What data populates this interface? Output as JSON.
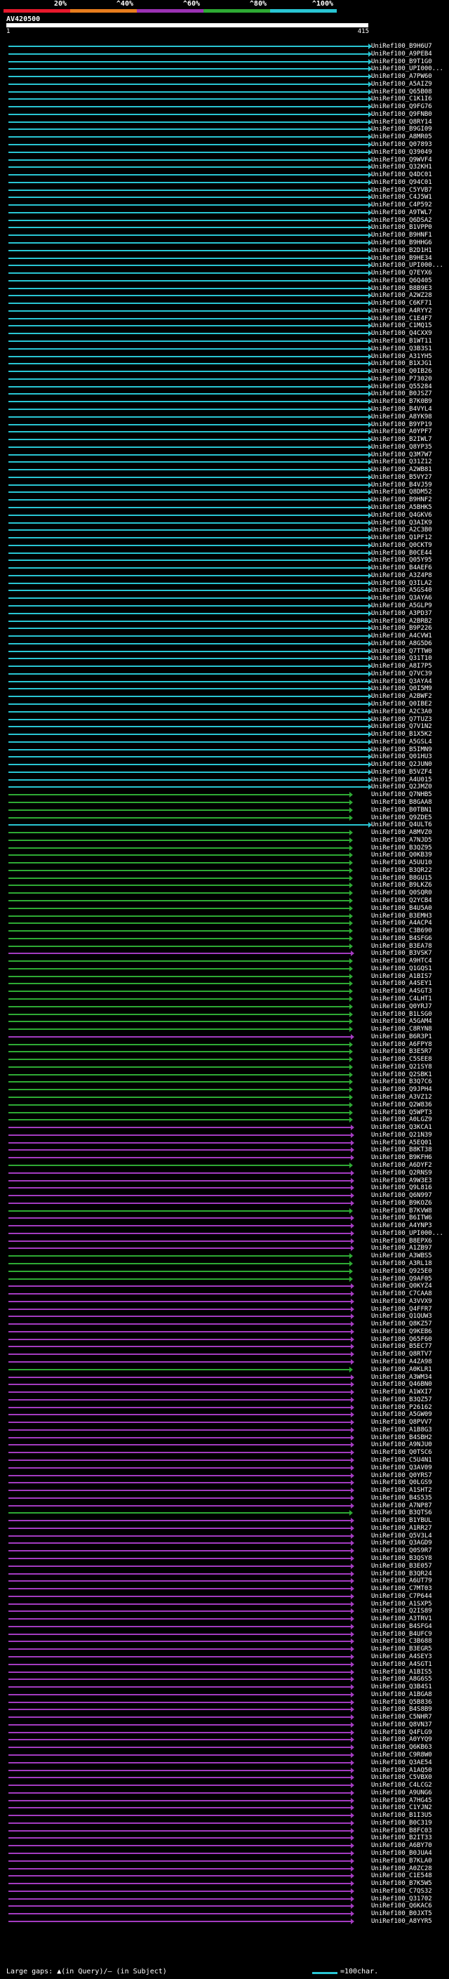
{
  "legend": {
    "labels": [
      "20%",
      "^40%",
      "^60%",
      "^80%",
      "^100%"
    ],
    "colors": [
      "#e8192c",
      "#e87d1e",
      "#9b32b4",
      "#2eaa34",
      "#29c5d3"
    ]
  },
  "query": {
    "name": "AV420500",
    "start": "1",
    "end": "415"
  },
  "hits": [
    {
      "label": "UniRef100_B9H6U7",
      "color": "cyan"
    },
    {
      "label": "UniRef100_A9PEB4",
      "color": "cyan"
    },
    {
      "label": "UniRef100_B9T1G0",
      "color": "cyan"
    },
    {
      "label": "UniRef100_UPI000...",
      "color": "cyan"
    },
    {
      "label": "UniRef100_A7PW60",
      "color": "cyan"
    },
    {
      "label": "UniRef100_A5AIZ9",
      "color": "cyan"
    },
    {
      "label": "UniRef100_Q65B08",
      "color": "cyan"
    },
    {
      "label": "UniRef100_C1K1I6",
      "color": "cyan"
    },
    {
      "label": "UniRef100_Q9FG76",
      "color": "cyan"
    },
    {
      "label": "UniRef100_Q9FNB0",
      "color": "cyan"
    },
    {
      "label": "UniRef100_Q8RY14",
      "color": "cyan"
    },
    {
      "label": "UniRef100_B9GI09",
      "color": "cyan"
    },
    {
      "label": "UniRef100_A8MR05",
      "color": "cyan"
    },
    {
      "label": "UniRef100_Q07893",
      "color": "cyan"
    },
    {
      "label": "UniRef100_Q39049",
      "color": "cyan"
    },
    {
      "label": "UniRef100_Q9WVF4",
      "color": "cyan"
    },
    {
      "label": "UniRef100_Q32KH1",
      "color": "cyan"
    },
    {
      "label": "UniRef100_Q4DC01",
      "color": "cyan"
    },
    {
      "label": "UniRef100_Q94C01",
      "color": "cyan"
    },
    {
      "label": "UniRef100_C5YVB7",
      "color": "cyan"
    },
    {
      "label": "UniRef100_C4J5W1",
      "color": "cyan"
    },
    {
      "label": "UniRef100_C4P592",
      "color": "cyan"
    },
    {
      "label": "UniRef100_A9TWL7",
      "color": "cyan"
    },
    {
      "label": "UniRef100_Q6DSA2",
      "color": "cyan"
    },
    {
      "label": "UniRef100_B1VPP0",
      "color": "cyan"
    },
    {
      "label": "UniRef100_B9HNF1",
      "color": "cyan"
    },
    {
      "label": "UniRef100_B9HHG6",
      "color": "cyan"
    },
    {
      "label": "UniRef100_B2D1H1",
      "color": "cyan"
    },
    {
      "label": "UniRef100_B9HE34",
      "color": "cyan"
    },
    {
      "label": "UniRef100_UPI000...",
      "color": "cyan"
    },
    {
      "label": "UniRef100_Q7EYX6",
      "color": "cyan"
    },
    {
      "label": "UniRef100_Q6Q405",
      "color": "cyan"
    },
    {
      "label": "UniRef100_B8B9E3",
      "color": "cyan"
    },
    {
      "label": "UniRef100_A2WZ28",
      "color": "cyan"
    },
    {
      "label": "UniRef100_C6KF71",
      "color": "cyan"
    },
    {
      "label": "UniRef100_A4RYY2",
      "color": "cyan"
    },
    {
      "label": "UniRef100_C1E4F7",
      "color": "cyan"
    },
    {
      "label": "UniRef100_C1MQ15",
      "color": "cyan"
    },
    {
      "label": "UniRef100_Q4CXX9",
      "color": "cyan"
    },
    {
      "label": "UniRef100_B1WT11",
      "color": "cyan"
    },
    {
      "label": "UniRef100_Q3B3S1",
      "color": "cyan"
    },
    {
      "label": "UniRef100_A31YH5",
      "color": "cyan"
    },
    {
      "label": "UniRef100_B1XJG1",
      "color": "cyan"
    },
    {
      "label": "UniRef100_Q0IB26",
      "color": "cyan"
    },
    {
      "label": "UniRef100_P73020",
      "color": "cyan"
    },
    {
      "label": "UniRef100_Q55284",
      "color": "cyan"
    },
    {
      "label": "UniRef100_B0JSZ7",
      "color": "cyan"
    },
    {
      "label": "UniRef100_B7K0B9",
      "color": "cyan"
    },
    {
      "label": "UniRef100_B4VYL4",
      "color": "cyan"
    },
    {
      "label": "UniRef100_A8YK98",
      "color": "cyan"
    },
    {
      "label": "UniRef100_B9YP19",
      "color": "cyan"
    },
    {
      "label": "UniRef100_A0YPF7",
      "color": "cyan"
    },
    {
      "label": "UniRef100_B2IWL7",
      "color": "cyan"
    },
    {
      "label": "UniRef100_Q8YP35",
      "color": "cyan"
    },
    {
      "label": "UniRef100_Q3M7W7",
      "color": "cyan"
    },
    {
      "label": "UniRef100_Q31Z12",
      "color": "cyan"
    },
    {
      "label": "UniRef100_A2WB81",
      "color": "cyan"
    },
    {
      "label": "UniRef100_B5VY27",
      "color": "cyan"
    },
    {
      "label": "UniRef100_B4VJ59",
      "color": "cyan"
    },
    {
      "label": "UniRef100_Q8DM52",
      "color": "cyan"
    },
    {
      "label": "UniRef100_B9HNF2",
      "color": "cyan"
    },
    {
      "label": "UniRef100_A5BHK5",
      "color": "cyan"
    },
    {
      "label": "UniRef100_Q4GKV6",
      "color": "cyan"
    },
    {
      "label": "UniRef100_Q3AIK9",
      "color": "cyan"
    },
    {
      "label": "UniRef100_A2C3B0",
      "color": "cyan"
    },
    {
      "label": "UniRef100_Q1PF12",
      "color": "cyan"
    },
    {
      "label": "UniRef100_Q0CKT9",
      "color": "cyan"
    },
    {
      "label": "UniRef100_B0CE44",
      "color": "cyan"
    },
    {
      "label": "UniRef100_Q05Y95",
      "color": "cyan"
    },
    {
      "label": "UniRef100_B4AEF6",
      "color": "cyan"
    },
    {
      "label": "UniRef100_A3Z4P8",
      "color": "cyan"
    },
    {
      "label": "UniRef100_Q3ILA2",
      "color": "cyan"
    },
    {
      "label": "UniRef100_A5GS40",
      "color": "cyan"
    },
    {
      "label": "UniRef100_Q3AYA6",
      "color": "cyan"
    },
    {
      "label": "UniRef100_A5GLP9",
      "color": "cyan"
    },
    {
      "label": "UniRef100_A3PD37",
      "color": "cyan"
    },
    {
      "label": "UniRef100_A2BRB2",
      "color": "cyan"
    },
    {
      "label": "UniRef100_B9P226",
      "color": "cyan"
    },
    {
      "label": "UniRef100_A4CVW1",
      "color": "cyan"
    },
    {
      "label": "UniRef100_A8G5D6",
      "color": "cyan"
    },
    {
      "label": "UniRef100_Q7TTW0",
      "color": "cyan"
    },
    {
      "label": "UniRef100_Q31T10",
      "color": "cyan"
    },
    {
      "label": "UniRef100_A8I7P5",
      "color": "cyan"
    },
    {
      "label": "UniRef100_Q7VC39",
      "color": "cyan"
    },
    {
      "label": "UniRef100_Q3AYA4",
      "color": "cyan"
    },
    {
      "label": "UniRef100_Q0I5M9",
      "color": "cyan"
    },
    {
      "label": "UniRef100_A2BWF2",
      "color": "cyan"
    },
    {
      "label": "UniRef100_Q0IBE2",
      "color": "cyan"
    },
    {
      "label": "UniRef100_A2C3A0",
      "color": "cyan"
    },
    {
      "label": "UniRef100_Q7TUZ3",
      "color": "cyan"
    },
    {
      "label": "UniRef100_Q7V1N2",
      "color": "cyan"
    },
    {
      "label": "UniRef100_B1X5K2",
      "color": "cyan"
    },
    {
      "label": "UniRef100_A5GSL4",
      "color": "cyan"
    },
    {
      "label": "UniRef100_B5IMN9",
      "color": "cyan"
    },
    {
      "label": "UniRef100_Q01HU3",
      "color": "cyan"
    },
    {
      "label": "UniRef100_Q2JUN0",
      "color": "cyan"
    },
    {
      "label": "UniRef100_B5VZF4",
      "color": "cyan"
    },
    {
      "label": "UniRef100_A4U015",
      "color": "cyan"
    },
    {
      "label": "UniRef100_Q2JMZ0",
      "color": "cyan"
    },
    {
      "label": "UniRef100_Q7NHB5",
      "color": "green"
    },
    {
      "label": "UniRef100_B8GAA8",
      "color": "green"
    },
    {
      "label": "UniRef100_B0TBN1",
      "color": "green"
    },
    {
      "label": "UniRef100_Q9ZDE5",
      "color": "green"
    },
    {
      "label": "UniRef100_Q4ULT6",
      "color": "cyan"
    },
    {
      "label": "UniRef100_A8MVZ0",
      "color": "green"
    },
    {
      "label": "UniRef100_A7NJD5",
      "color": "green"
    },
    {
      "label": "UniRef100_B3QZ95",
      "color": "green"
    },
    {
      "label": "UniRef100_Q0KB39",
      "color": "green"
    },
    {
      "label": "UniRef100_A5UU10",
      "color": "green"
    },
    {
      "label": "UniRef100_B3QR22",
      "color": "green"
    },
    {
      "label": "UniRef100_B8GU15",
      "color": "green"
    },
    {
      "label": "UniRef100_B9LKZ6",
      "color": "green"
    },
    {
      "label": "UniRef100_Q0SQR0",
      "color": "green"
    },
    {
      "label": "UniRef100_Q2YCB4",
      "color": "green"
    },
    {
      "label": "UniRef100_B4U5A0",
      "color": "green"
    },
    {
      "label": "UniRef100_B3EMH3",
      "color": "green"
    },
    {
      "label": "UniRef100_A4ACP4",
      "color": "green"
    },
    {
      "label": "UniRef100_C3B690",
      "color": "green"
    },
    {
      "label": "UniRef100_B4SFG6",
      "color": "green"
    },
    {
      "label": "UniRef100_B3EA78",
      "color": "green"
    },
    {
      "label": "UniRef100_B3VSK7",
      "color": "purple"
    },
    {
      "label": "UniRef100_A9HTC4",
      "color": "green"
    },
    {
      "label": "UniRef100_Q1GQS1",
      "color": "green"
    },
    {
      "label": "UniRef100_A1BIS7",
      "color": "green"
    },
    {
      "label": "UniRef100_A4SEY1",
      "color": "green"
    },
    {
      "label": "UniRef100_A4SGT3",
      "color": "green"
    },
    {
      "label": "UniRef100_C4LHT1",
      "color": "green"
    },
    {
      "label": "UniRef100_Q0YRJ7",
      "color": "green"
    },
    {
      "label": "UniRef100_B1LSG0",
      "color": "green"
    },
    {
      "label": "UniRef100_A5GAM4",
      "color": "green"
    },
    {
      "label": "UniRef100_C8RYN8",
      "color": "green"
    },
    {
      "label": "UniRef100_B6R3P1",
      "color": "purple"
    },
    {
      "label": "UniRef100_A6FPY8",
      "color": "green"
    },
    {
      "label": "UniRef100_B3E5R7",
      "color": "green"
    },
    {
      "label": "UniRef100_C5SEE8",
      "color": "green"
    },
    {
      "label": "UniRef100_Q21SY8",
      "color": "green"
    },
    {
      "label": "UniRef100_Q2SBK1",
      "color": "green"
    },
    {
      "label": "UniRef100_B3Q7C6",
      "color": "green"
    },
    {
      "label": "UniRef100_Q9JPH4",
      "color": "green"
    },
    {
      "label": "UniRef100_A3VZ12",
      "color": "green"
    },
    {
      "label": "UniRef100_Q2W836",
      "color": "green"
    },
    {
      "label": "UniRef100_Q5WPT3",
      "color": "green"
    },
    {
      "label": "UniRef100_A0LGZ9",
      "color": "green"
    },
    {
      "label": "UniRef100_Q3KCA1",
      "color": "purple"
    },
    {
      "label": "UniRef100_Q21N39",
      "color": "purple"
    },
    {
      "label": "UniRef100_A5EQ01",
      "color": "purple"
    },
    {
      "label": "UniRef100_B8KT38",
      "color": "purple"
    },
    {
      "label": "UniRef100_B9KFH6",
      "color": "purple"
    },
    {
      "label": "UniRef100_A6DYF2",
      "color": "green"
    },
    {
      "label": "UniRef100_Q2RNS9",
      "color": "purple"
    },
    {
      "label": "UniRef100_A9W3E3",
      "color": "purple"
    },
    {
      "label": "UniRef100_Q9L816",
      "color": "purple"
    },
    {
      "label": "UniRef100_Q6N997",
      "color": "purple"
    },
    {
      "label": "UniRef100_B9KOZ6",
      "color": "purple"
    },
    {
      "label": "UniRef100_B7KVW8",
      "color": "green"
    },
    {
      "label": "UniRef100_B6ITW6",
      "color": "purple"
    },
    {
      "label": "UniRef100_A4YNP3",
      "color": "purple"
    },
    {
      "label": "UniRef100_UPI000...",
      "color": "purple"
    },
    {
      "label": "UniRef100_B8EPX6",
      "color": "purple"
    },
    {
      "label": "UniRef100_A1ZB97",
      "color": "purple"
    },
    {
      "label": "UniRef100_A3WBS5",
      "color": "green"
    },
    {
      "label": "UniRef100_A3RL18",
      "color": "green"
    },
    {
      "label": "UniRef100_Q925E0",
      "color": "green"
    },
    {
      "label": "UniRef100_Q9AF05",
      "color": "green"
    },
    {
      "label": "UniRef100_Q0KYZ4",
      "color": "purple"
    },
    {
      "label": "UniRef100_C7CAA8",
      "color": "purple"
    },
    {
      "label": "UniRef100_A3VVX9",
      "color": "purple"
    },
    {
      "label": "UniRef100_Q4FFR7",
      "color": "purple"
    },
    {
      "label": "UniRef100_Q1QUW3",
      "color": "purple"
    },
    {
      "label": "UniRef100_Q8KZ57",
      "color": "purple"
    },
    {
      "label": "UniRef100_Q9KEB6",
      "color": "purple"
    },
    {
      "label": "UniRef100_Q65F60",
      "color": "purple"
    },
    {
      "label": "UniRef100_B5EC77",
      "color": "purple"
    },
    {
      "label": "UniRef100_Q8RTV7",
      "color": "purple"
    },
    {
      "label": "UniRef100_A4ZA98",
      "color": "purple"
    },
    {
      "label": "UniRef100_A0KLR1",
      "color": "green"
    },
    {
      "label": "UniRef100_A3WM34",
      "color": "purple"
    },
    {
      "label": "UniRef100_Q46BN0",
      "color": "purple"
    },
    {
      "label": "UniRef100_A1WXI7",
      "color": "purple"
    },
    {
      "label": "UniRef100_B3QZ57",
      "color": "purple"
    },
    {
      "label": "UniRef100_P26162",
      "color": "purple"
    },
    {
      "label": "UniRef100_A5GW09",
      "color": "purple"
    },
    {
      "label": "UniRef100_Q8PVV7",
      "color": "purple"
    },
    {
      "label": "UniRef100_A1B8G3",
      "color": "purple"
    },
    {
      "label": "UniRef100_B4SBH2",
      "color": "purple"
    },
    {
      "label": "UniRef100_A9NJU0",
      "color": "purple"
    },
    {
      "label": "UniRef100_Q0TSC6",
      "color": "purple"
    },
    {
      "label": "UniRef100_C5U4N1",
      "color": "purple"
    },
    {
      "label": "UniRef100_Q3AV09",
      "color": "purple"
    },
    {
      "label": "UniRef100_Q0YRS7",
      "color": "purple"
    },
    {
      "label": "UniRef100_Q0LGS9",
      "color": "purple"
    },
    {
      "label": "UniRef100_A1SHT2",
      "color": "purple"
    },
    {
      "label": "UniRef100_B4S535",
      "color": "purple"
    },
    {
      "label": "UniRef100_A7NP87",
      "color": "purple"
    },
    {
      "label": "UniRef100_B3QTS6",
      "color": "green"
    },
    {
      "label": "UniRef100_B1YBUL",
      "color": "purple"
    },
    {
      "label": "UniRef100_A1RR27",
      "color": "purple"
    },
    {
      "label": "UniRef100_Q5V3L4",
      "color": "purple"
    },
    {
      "label": "UniRef100_Q3AGD9",
      "color": "purple"
    },
    {
      "label": "UniRef100_Q0S9R7",
      "color": "purple"
    },
    {
      "label": "UniRef100_B3QSY8",
      "color": "purple"
    },
    {
      "label": "UniRef100_B3E057",
      "color": "purple"
    },
    {
      "label": "UniRef100_B3QR24",
      "color": "purple"
    },
    {
      "label": "UniRef100_A6UT79",
      "color": "purple"
    },
    {
      "label": "UniRef100_C7MT03",
      "color": "purple"
    },
    {
      "label": "UniRef100_C7P644",
      "color": "purple"
    },
    {
      "label": "UniRef100_A1SXP5",
      "color": "purple"
    },
    {
      "label": "UniRef100_Q2IS89",
      "color": "purple"
    },
    {
      "label": "UniRef100_A3TRV1",
      "color": "purple"
    },
    {
      "label": "UniRef100_B4SFG4",
      "color": "purple"
    },
    {
      "label": "UniRef100_B4UFC9",
      "color": "purple"
    },
    {
      "label": "UniRef100_C3B688",
      "color": "purple"
    },
    {
      "label": "UniRef100_B3EGR5",
      "color": "purple"
    },
    {
      "label": "UniRef100_A4SEY3",
      "color": "purple"
    },
    {
      "label": "UniRef100_A4SGT1",
      "color": "purple"
    },
    {
      "label": "UniRef100_A1BIS5",
      "color": "purple"
    },
    {
      "label": "UniRef100_A8G6S5",
      "color": "purple"
    },
    {
      "label": "UniRef100_Q3B4S1",
      "color": "purple"
    },
    {
      "label": "UniRef100_A1BGA8",
      "color": "purple"
    },
    {
      "label": "UniRef100_Q5B836",
      "color": "purple"
    },
    {
      "label": "UniRef100_B4S8B9",
      "color": "purple"
    },
    {
      "label": "UniRef100_C5NHR7",
      "color": "purple"
    },
    {
      "label": "UniRef100_Q8VN37",
      "color": "purple"
    },
    {
      "label": "UniRef100_Q4FLG9",
      "color": "purple"
    },
    {
      "label": "UniRef100_A0YYQ9",
      "color": "purple"
    },
    {
      "label": "UniRef100_Q6KB63",
      "color": "purple"
    },
    {
      "label": "UniRef100_C9R8W0",
      "color": "purple"
    },
    {
      "label": "UniRef100_Q3AE54",
      "color": "purple"
    },
    {
      "label": "UniRef100_A1AQ50",
      "color": "purple"
    },
    {
      "label": "UniRef100_C5VBX0",
      "color": "purple"
    },
    {
      "label": "UniRef100_C4LCG2",
      "color": "purple"
    },
    {
      "label": "UniRef100_A9UNG6",
      "color": "purple"
    },
    {
      "label": "UniRef100_A7HG45",
      "color": "purple"
    },
    {
      "label": "UniRef100_C1YJN2",
      "color": "purple"
    },
    {
      "label": "UniRef100_B1I3U5",
      "color": "purple"
    },
    {
      "label": "UniRef100_B0C319",
      "color": "purple"
    },
    {
      "label": "UniRef100_B8FC03",
      "color": "purple"
    },
    {
      "label": "UniRef100_B2IT33",
      "color": "purple"
    },
    {
      "label": "UniRef100_A6BY70",
      "color": "purple"
    },
    {
      "label": "UniRef100_B0JUA4",
      "color": "purple"
    },
    {
      "label": "UniRef100_B7KLA0",
      "color": "purple"
    },
    {
      "label": "UniRef100_A0ZC28",
      "color": "purple"
    },
    {
      "label": "UniRef100_C1E548",
      "color": "purple"
    },
    {
      "label": "UniRef100_B7K5W5",
      "color": "purple"
    },
    {
      "label": "UniRef100_C7QS32",
      "color": "purple"
    },
    {
      "label": "UniRef100_Q31702",
      "color": "purple"
    },
    {
      "label": "UniRef100_Q6KAC6",
      "color": "purple"
    },
    {
      "label": "UniRef100_B0JXT5",
      "color": "purple"
    },
    {
      "label": "UniRef100_A8YYR5",
      "color": "purple"
    }
  ],
  "footer": {
    "gaps_text": "Large gaps: ▲(in Query)/– (in Subject)",
    "scale_text": "=100char."
  },
  "hit_colors": {
    "cyan": "#29c5d3",
    "green": "#2eaa34",
    "purple": "#a33bc0"
  }
}
